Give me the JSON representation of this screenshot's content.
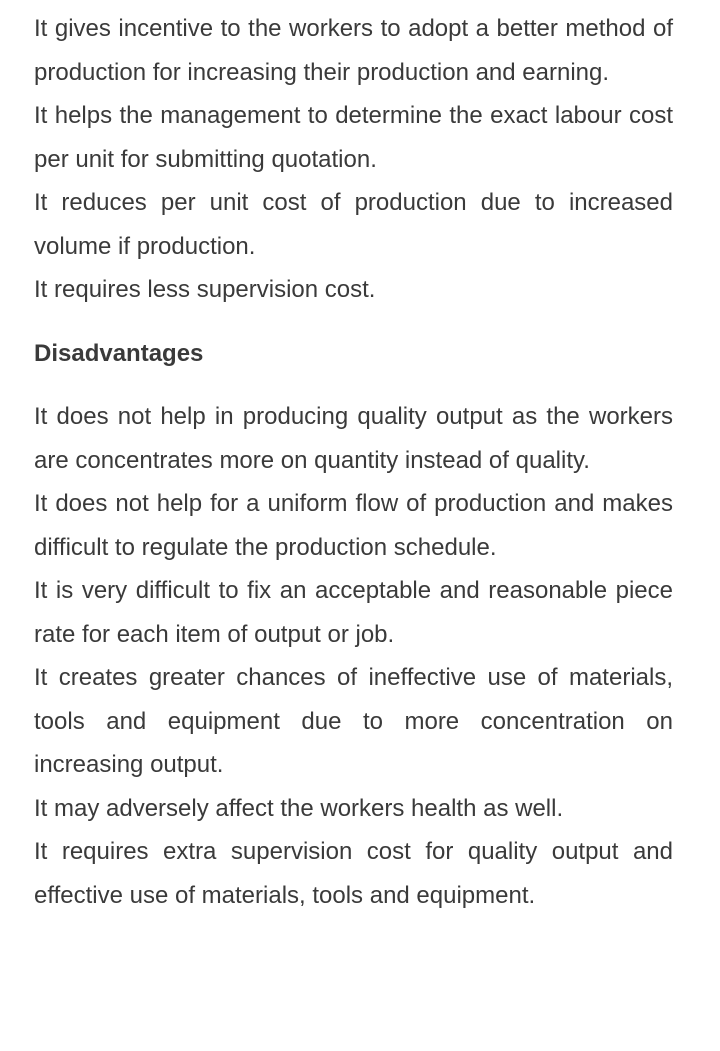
{
  "advantages": [
    "It gives incentive to the workers to adopt a better method of production for increasing their production and earning.",
    "It helps the management to determine the exact labour cost per unit for submitting quotation.",
    "It reduces per unit cost of production due to increased volume if production.",
    "It requires less supervision cost."
  ],
  "disadvantages_heading": "Disadvantages",
  "disadvantages": [
    "It does not help in producing quality output as the workers are concentrates more on quantity instead of quality.",
    "It does not help for a uniform flow of production and makes difficult to regulate the production schedule.",
    "It is very difficult to fix an acceptable and reasonable piece rate for each item of output or job.",
    "It creates greater chances of ineffective use of materials, tools and equipment due to more concentration on increasing output.",
    "It may adversely affect the workers health as well.",
    "It requires extra supervision cost for quality output and effective use of materials, tools and equipment."
  ]
}
